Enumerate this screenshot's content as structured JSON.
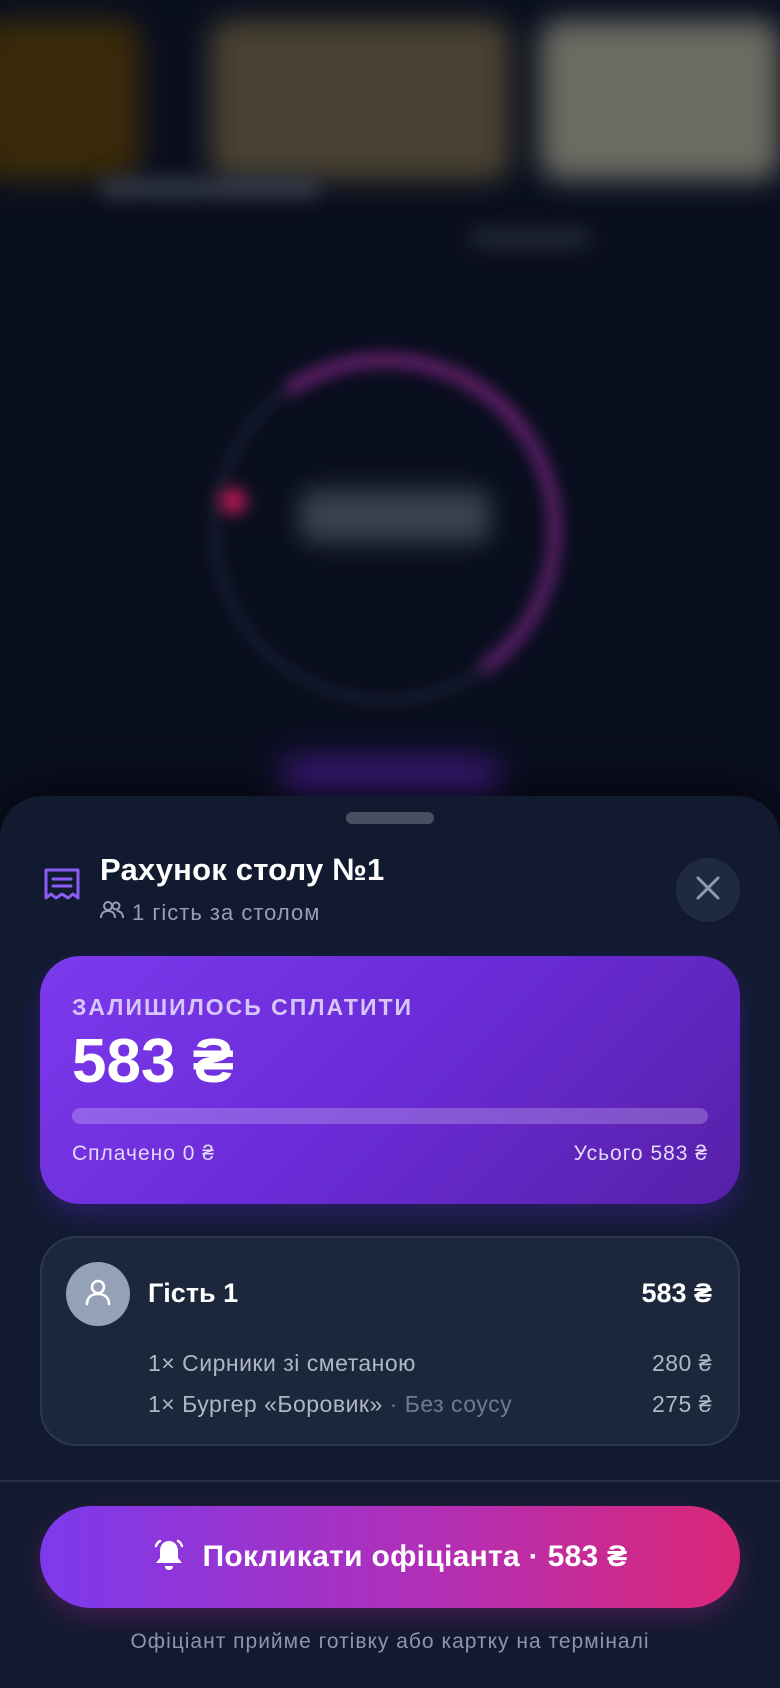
{
  "sheet": {
    "title": "Рахунок столу №1",
    "guests_label": "1 гість за столом",
    "summary": {
      "label": "ЗАЛИШИЛОСЬ СПЛАТИТИ",
      "amount": "583 ₴",
      "paid": "Сплачено 0 ₴",
      "total": "Усього 583 ₴",
      "paid_fraction": 0
    },
    "guests": [
      {
        "name": "Гість 1",
        "total": "583 ₴",
        "items": [
          {
            "text": "1× Сирники зі сметаною",
            "note": "",
            "price": "280 ₴"
          },
          {
            "text": "1× Бургер «Боровик»",
            "note": " · Без соусу",
            "price": "275 ₴"
          }
        ]
      }
    ],
    "call_button": "Покликати офіціанта · 583 ₴",
    "footnote": "Офіціант прийме готівку або картку на терміналі"
  },
  "colors": {
    "accent_purple": "#7c3aed",
    "accent_pink": "#db2777",
    "sheet_bg": "#111a2e",
    "card_bg": "#1c273b"
  },
  "icons": {
    "header": "receipt-icon",
    "guests": "users-icon",
    "close": "close-icon",
    "avatar": "user-icon",
    "call": "bell-icon"
  }
}
